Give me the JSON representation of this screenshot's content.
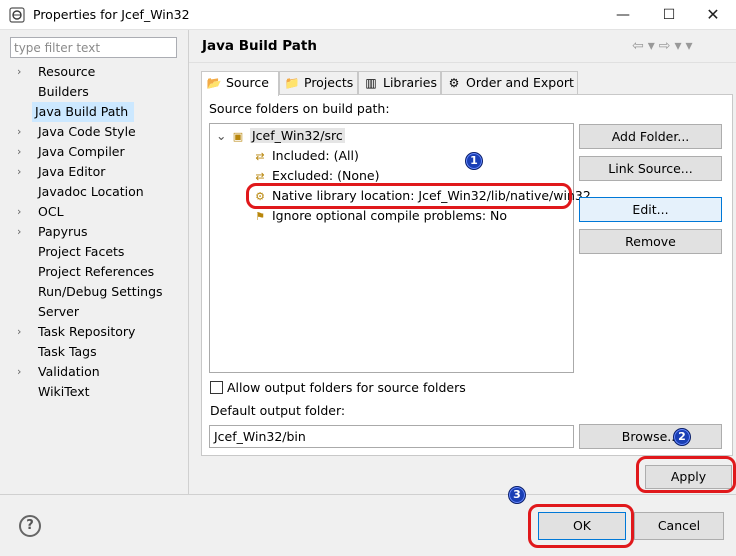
{
  "window": {
    "title": "Properties for Jcef_Win32",
    "minimize": "—",
    "maximize": "☐",
    "close": "✕"
  },
  "filter": {
    "placeholder": "type filter text"
  },
  "nav_tree": [
    {
      "label": "Resource",
      "arrow": "›"
    },
    {
      "label": "Builders",
      "arrow": ""
    },
    {
      "label": "Java Build Path",
      "arrow": "",
      "selected": true
    },
    {
      "label": "Java Code Style",
      "arrow": "›"
    },
    {
      "label": "Java Compiler",
      "arrow": "›"
    },
    {
      "label": "Java Editor",
      "arrow": "›"
    },
    {
      "label": "Javadoc Location",
      "arrow": ""
    },
    {
      "label": "OCL",
      "arrow": "›"
    },
    {
      "label": "Papyrus",
      "arrow": "›"
    },
    {
      "label": "Project Facets",
      "arrow": ""
    },
    {
      "label": "Project References",
      "arrow": ""
    },
    {
      "label": "Run/Debug Settings",
      "arrow": ""
    },
    {
      "label": "Server",
      "arrow": ""
    },
    {
      "label": "Task Repository",
      "arrow": "›"
    },
    {
      "label": "Task Tags",
      "arrow": ""
    },
    {
      "label": "Validation",
      "arrow": "›"
    },
    {
      "label": "WikiText",
      "arrow": ""
    }
  ],
  "page": {
    "title": "Java Build Path",
    "nav_icons": "⇦▾⇨▾▾"
  },
  "tabs": [
    {
      "label": "Source",
      "icon": "📂",
      "active": true
    },
    {
      "label": "Projects",
      "icon": "📁"
    },
    {
      "label": "Libraries",
      "icon": "▥"
    },
    {
      "label": "Order and Export",
      "icon": "⚙"
    }
  ],
  "source": {
    "section_label": "Source folders on build path:",
    "root": {
      "label": "Jcef_Win32/src",
      "expander": "⌄"
    },
    "children": [
      {
        "label": "Included: (All)"
      },
      {
        "label": "Excluded: (None)"
      },
      {
        "label": "Native library location: Jcef_Win32/lib/native/win32"
      },
      {
        "label": "Ignore optional compile problems: No"
      }
    ],
    "buttons": {
      "add_folder": "Add Folder...",
      "link_source": "Link Source...",
      "edit": "Edit...",
      "remove": "Remove"
    },
    "allow_output_label": "Allow output folders for source folders",
    "default_output_label": "Default output folder:",
    "default_output_value": "Jcef_Win32/bin",
    "browse": "Browse..."
  },
  "footer": {
    "apply": "Apply",
    "help": "?",
    "ok": "OK",
    "cancel": "Cancel"
  },
  "annotations": {
    "badge1": "1",
    "badge2": "2",
    "badge3": "3",
    "highlight_color": "#e0181b",
    "badge_color": "#1a3fb5"
  }
}
